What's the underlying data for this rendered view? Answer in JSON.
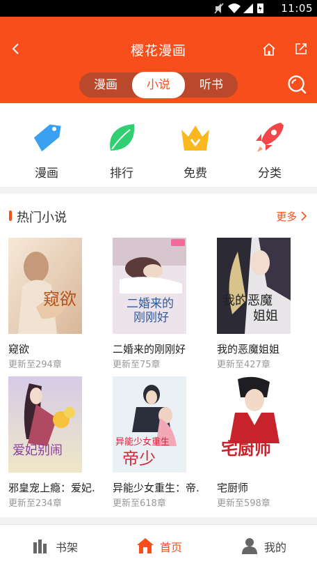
{
  "status_bar": {
    "time": "11:05",
    "icons": [
      "mute-icon",
      "wifi-icon",
      "signal-icon",
      "battery-icon"
    ]
  },
  "header": {
    "title": "樱花漫画",
    "tabs": [
      {
        "label": "漫画",
        "active": false
      },
      {
        "label": "小说",
        "active": true
      },
      {
        "label": "听书",
        "active": false
      }
    ],
    "icons": [
      "back-arrow-icon",
      "home-icon",
      "share-icon",
      "search-icon"
    ]
  },
  "categories": [
    {
      "label": "漫画",
      "icon": "tag-icon",
      "color": "#3aa0f0"
    },
    {
      "label": "排行",
      "icon": "leaf-icon",
      "color": "#2fcf72"
    },
    {
      "label": "免费",
      "icon": "crown-icon",
      "color": "#f8b81e"
    },
    {
      "label": "分类",
      "icon": "rocket-icon",
      "color": "#f2464a"
    }
  ],
  "hot_section": {
    "title": "热门小说",
    "more_label": "更多"
  },
  "books": [
    {
      "name": "窥欲",
      "update": "更新至294章"
    },
    {
      "name": "二婚来的刚刚好",
      "update": "更新至75章"
    },
    {
      "name": "我的恶魔姐姐",
      "update": "更新至427章"
    },
    {
      "name": "邪皇宠上瘾：爱妃.",
      "update": "更新至234章"
    },
    {
      "name": "异能少女重生：帝.",
      "update": "更新至618章"
    },
    {
      "name": "宅厨师",
      "update": "更新至598章"
    }
  ],
  "bottom_nav": [
    {
      "label": "书架",
      "icon": "bookshelf-icon",
      "active": false
    },
    {
      "label": "首页",
      "icon": "home-icon",
      "active": true
    },
    {
      "label": "我的",
      "icon": "user-icon",
      "active": false
    }
  ],
  "colors": {
    "accent": "#f74e1c",
    "segment_bg": "#b9492a"
  }
}
